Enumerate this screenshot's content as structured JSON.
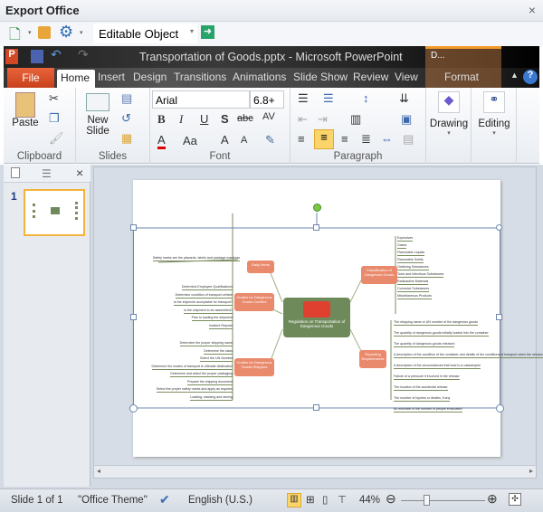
{
  "window": {
    "title": "Export Office",
    "close": "×"
  },
  "export_toolbar": {
    "mode": "Editable Object"
  },
  "ppt": {
    "title": "Transportation of Goods.pptx  -  Microsoft PowerPoint",
    "context_tab_short": "D...",
    "tabs": [
      "File",
      "Home",
      "Insert",
      "Design",
      "Transitions",
      "Animations",
      "Slide Show",
      "Review",
      "View",
      "Format"
    ]
  },
  "ribbon": {
    "clipboard": {
      "label": "Clipboard",
      "paste": "Paste"
    },
    "slides": {
      "label": "Slides",
      "new_slide": "New Slide"
    },
    "font": {
      "label": "Font",
      "name": "Arial",
      "size": "6.8+"
    },
    "paragraph": {
      "label": "Paragraph"
    },
    "drawing": "Drawing",
    "editing": "Editing"
  },
  "left_pane": {
    "slide_number": "1"
  },
  "slide": {
    "center": "Regulation on Transportation of Dangerous Goods",
    "branches": [
      {
        "label": "Daily Items",
        "leaves": [
          "Safety marks are the placards, labels and package markings"
        ]
      },
      {
        "label": "Guides for Dangerous Goods Carriers",
        "leaves": [
          "Determine Employee Qualifications",
          "Determine condition of transport vehicle",
          "Is the shipment acceptable for transport?",
          "Is the shipment to be assembled?",
          "Plan to loading the shipment",
          "Incident Reports"
        ]
      },
      {
        "label": "Guides for Dangerous Goods Shippers",
        "leaves": [
          "Determine the proper shipping name",
          "Determine the class",
          "Select the UN Number",
          "Determine the modes of transport to ultimate destination",
          "Determine and select the proper packaging",
          "Prepare the shipping document",
          "Select the proper safety marks and apply as required",
          "Loading, stacking and storing"
        ]
      },
      {
        "label": "Classification of Dangerous Goods",
        "leaves": [
          "Explosives",
          "Gases",
          "Flammable Liquids",
          "Flammable Solids",
          "Oxidizing Substances",
          "Toxic and Infectious Substances",
          "Radioactive Materials",
          "Corrosive Substances",
          "Miscellaneous Products"
        ]
      },
      {
        "label": "Reporting Requirements",
        "leaves": [
          "The shipping name or UN number of the dangerous goods",
          "The quantity of dangerous goods initially loaded into the container",
          "The quantity of dangerous goods released",
          "A description of the condition of the container and details of the conditions of transport when the release took place",
          "A description of the circumstances that lead to a catastrophe",
          "Failure of a pressure if involved in the release",
          "The location of the accidental release",
          "The number of injuries or deaths, if any",
          "An estimate of the number of people evacuated"
        ]
      }
    ]
  },
  "status": {
    "slide": "Slide 1 of 1",
    "theme": "\"Office Theme\"",
    "language": "English (U.S.)",
    "zoom": "44%",
    "zoom_fraction": 0.3
  },
  "colors": {
    "file_tab": "#d9532c",
    "node": "#ea8a6d",
    "center": "#6e8a5a",
    "context": "#f19a2a"
  }
}
